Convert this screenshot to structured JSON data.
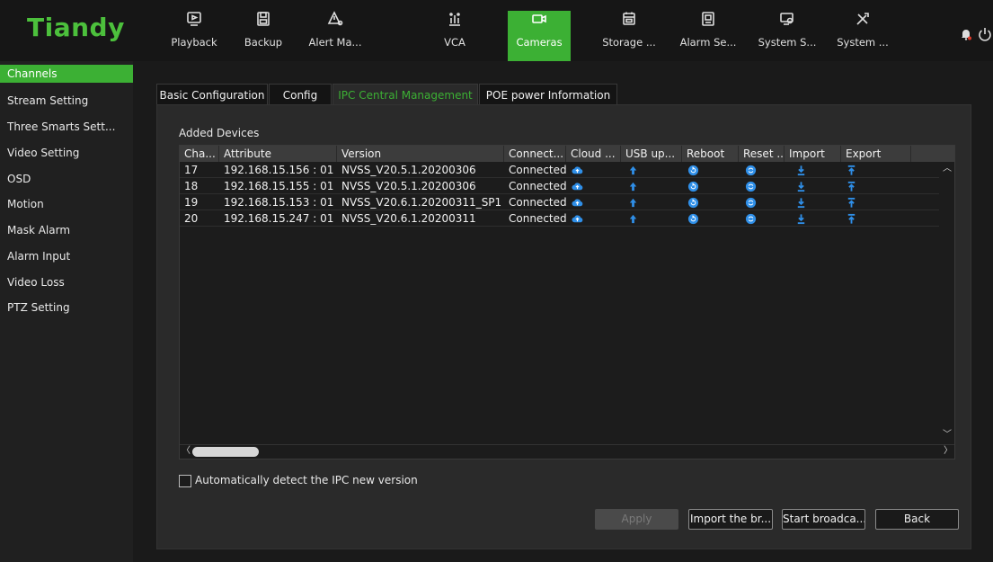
{
  "app": {
    "logo": "Tiandy"
  },
  "nav": [
    {
      "label": "Playback",
      "icon": "playback-icon"
    },
    {
      "label": "Backup",
      "icon": "save-icon"
    },
    {
      "label": "Alert Ma...",
      "icon": "alert-icon"
    },
    {
      "label": "VCA",
      "icon": "vca-icon"
    },
    {
      "label": "Cameras",
      "icon": "camera-icon",
      "active": true
    },
    {
      "label": "Storage ...",
      "icon": "storage-icon"
    },
    {
      "label": "Alarm Se...",
      "icon": "alarm-icon"
    },
    {
      "label": "System S...",
      "icon": "system-settings-icon"
    },
    {
      "label": "System ...",
      "icon": "tools-icon"
    }
  ],
  "sidebar": {
    "items": [
      {
        "label": "Channels",
        "active": true
      },
      {
        "label": "Stream Setting"
      },
      {
        "label": "Three Smarts Sett..."
      },
      {
        "label": "Video Setting"
      },
      {
        "label": "OSD"
      },
      {
        "label": "Motion"
      },
      {
        "label": "Mask Alarm"
      },
      {
        "label": "Alarm Input"
      },
      {
        "label": "Video Loss"
      },
      {
        "label": "PTZ Setting"
      }
    ]
  },
  "tabs": [
    {
      "label": "Basic Configuration"
    },
    {
      "label": "Config"
    },
    {
      "label": "IPC Central Management",
      "active": true
    },
    {
      "label": "POE power Information"
    }
  ],
  "section_title": "Added Devices",
  "table": {
    "headers": [
      "Cha...",
      "Attribute",
      "Version",
      "Connect...",
      "Cloud ...",
      "USB up...",
      "Reboot",
      "Reset ...",
      "Import",
      "Export"
    ],
    "rows": [
      {
        "channel": "17",
        "attribute": "192.168.15.156 : 01",
        "version": "NVSS_V20.5.1.20200306",
        "connection": "Connected"
      },
      {
        "channel": "18",
        "attribute": "192.168.15.155 : 01",
        "version": "NVSS_V20.5.1.20200306",
        "connection": "Connected"
      },
      {
        "channel": "19",
        "attribute": "192.168.15.153 : 01",
        "version": "NVSS_V20.6.1.20200311_SP1",
        "connection": "Connected"
      },
      {
        "channel": "20",
        "attribute": "192.168.15.247 : 01",
        "version": "NVSS_V20.6.1.20200311",
        "connection": "Connected"
      }
    ]
  },
  "auto_detect_label": "Automatically detect the IPC new version",
  "auto_detect_checked": false,
  "buttons": {
    "apply": "Apply",
    "import": "Import the br...",
    "broadcast": "Start broadca...",
    "back": "Back"
  },
  "colors": {
    "accent": "#3cb034",
    "icon_blue": "#2f8fe8"
  }
}
